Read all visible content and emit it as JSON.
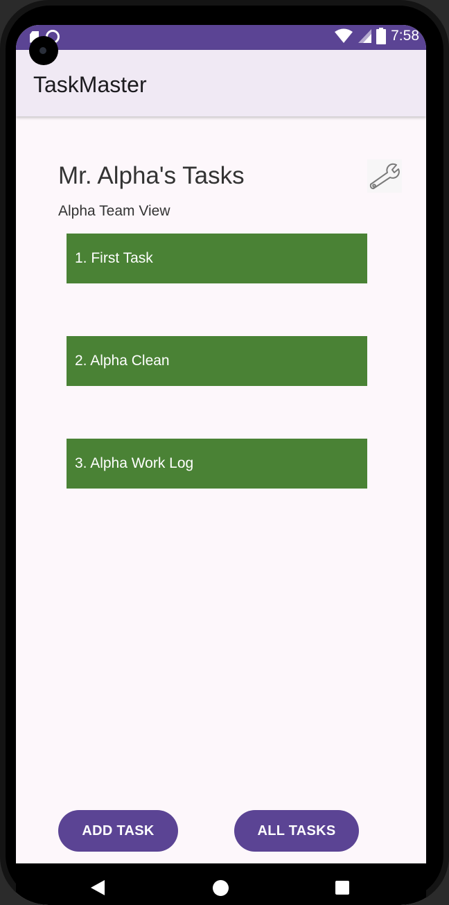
{
  "status_bar": {
    "time": "7:58",
    "icons": [
      "sd-card-icon",
      "sync-icon",
      "wifi-icon",
      "signal-icon",
      "battery-icon"
    ]
  },
  "app_bar": {
    "title": "TaskMaster"
  },
  "main": {
    "page_title": "Mr. Alpha's Tasks",
    "settings_icon": "wrench-icon",
    "team_label": "Alpha Team View",
    "tasks": [
      {
        "label": "1. First Task"
      },
      {
        "label": "2. Alpha Clean"
      },
      {
        "label": "3. Alpha Work Log"
      }
    ]
  },
  "actions": {
    "add_task_label": "ADD TASK",
    "all_tasks_label": "ALL TASKS"
  },
  "nav_bar": {
    "icons": [
      "back-icon",
      "home-icon",
      "recents-icon"
    ]
  },
  "colors": {
    "primary": "#5b4494",
    "task_green": "#4a8235",
    "app_bar_bg": "#f0e9f4",
    "screen_bg": "#fdf7fb"
  }
}
